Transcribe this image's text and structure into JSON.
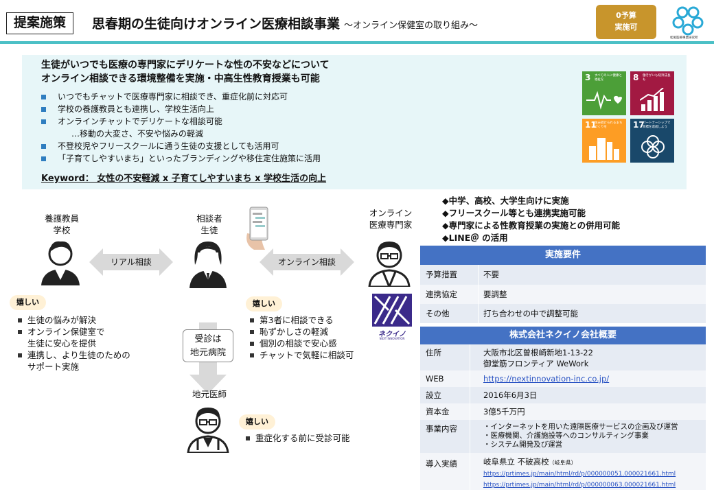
{
  "header": {
    "tag": "提案施策",
    "title": "思春期の生徒向けオンライン医療相談事業",
    "subtitle": "～オンライン保健室の取り組み～",
    "badge_line1": "0予算",
    "badge_line2": "実施可",
    "logo_text": "松尾医療事業研究所"
  },
  "summary": {
    "lead_line1": "生徒がいつでも医療の専門家にデリケートな性の不安などについて",
    "lead_line2": "オンライン相談できる環境整備を実施・中高生性教育授業も可能",
    "bullets": [
      "いつでもチャットで医療専門家に相談でき、重症化前に対応可",
      "学校の養護教員とも連携し、学校生活向上",
      "オンラインチャットでデリケートな相談可能",
      "…移動の大変さ、不安や悩みの軽減",
      "不登校児やフリースクールに通う生徒の支援としても活用可",
      "「子育てしやすいまち」といったブランディングや移住定住施策に活用"
    ],
    "keyword": "Keyword： 女性の不安軽減 x 子育てしやすいまち x 学校生活の向上"
  },
  "sdgs": [
    {
      "num": "3",
      "text": "すべての人に健康と福祉を",
      "color": "#4c9f38"
    },
    {
      "num": "8",
      "text": "働きがいも経済成長も",
      "color": "#a21942"
    },
    {
      "num": "11",
      "text": "住み続けられるまちづくりを",
      "color": "#fd9d24"
    },
    {
      "num": "17",
      "text": "パートナーシップで目標を達成しよう",
      "color": "#19486a"
    }
  ],
  "diagram": {
    "school_label1": "養護教員",
    "school_label2": "学校",
    "student_label1": "相談者",
    "student_label2": "生徒",
    "expert_label1": "オンライン",
    "expert_label2": "医療専門家",
    "arrow_real": "リアル相談",
    "arrow_online": "オンライン相談",
    "brand_text": "ネクイノ",
    "brand_sub": "NEXT INNOVATION",
    "happy": "嬉しい",
    "school_points": [
      "生徒の悩みが解決",
      "オンライン保健室で",
      "生徒に安心を提供",
      "連携し、より生徒のための",
      "サポート実施"
    ],
    "student_points": [
      "第3者に相談できる",
      "恥ずかしさの軽減",
      "個別の相談で安心感",
      "チャットで気軽に相談可"
    ],
    "visit_line1": "受診は",
    "visit_line2": "地元病院",
    "doctor_label": "地元医師",
    "doctor_points": [
      "重症化する前に受診可能"
    ]
  },
  "features": [
    "◆中学、高校、大学生向けに実施",
    "◆フリースクール等とも連携実施可能",
    "◆専門家による性教育授業の実施との併用可能",
    "◆LINE＠ の活用"
  ],
  "requirements": {
    "title": "実施要件",
    "rows": [
      {
        "k": "予算措置",
        "v": "不要"
      },
      {
        "k": "連携協定",
        "v": "要調整"
      },
      {
        "k": "その他",
        "v": "打ち合わせの中で調整可能"
      }
    ]
  },
  "company": {
    "title": "株式会社ネクイノ会社概要",
    "address_k": "住所",
    "address_v1": "大阪市北区曽根崎新地1-13-22",
    "address_v2": "御堂筋フロンティア WeWork",
    "web_k": "WEB",
    "web_v": "https://nextinnovation-inc.co.jp/",
    "est_k": "設立",
    "est_v": "2016年6月3日",
    "cap_k": "資本金",
    "cap_v": "3億5千万円",
    "biz_k": "事業内容",
    "biz_v": [
      "・インターネットを用いた遠隔医療サービスの企画及び運営",
      "・医療機関、介護施設等へのコンサルティング事業",
      "・システム開発及び運営"
    ],
    "intro_k": "導入実績",
    "intro_v": "岐阜県立 不破高校",
    "intro_pref": "（岐阜県）",
    "intro_links": [
      "https://prtimes.jp/main/html/rd/p/000000051.000021661.html",
      "https://prtimes.jp/main/html/rd/p/000000063.000021661.html"
    ]
  }
}
